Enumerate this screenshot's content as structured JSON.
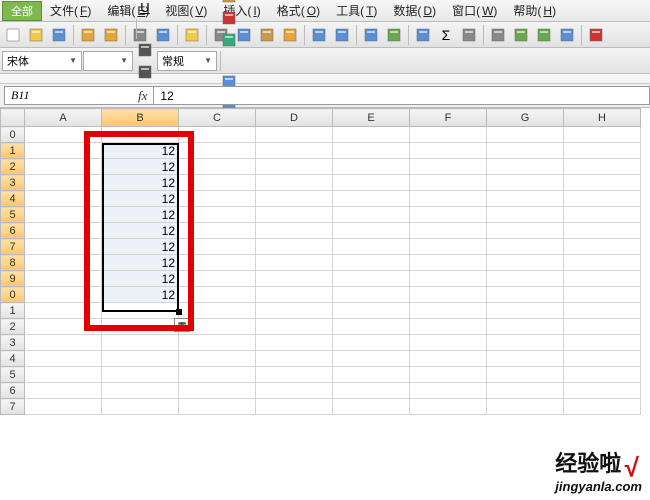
{
  "menu": {
    "all": "全部",
    "items": [
      {
        "label": "文件",
        "key": "F"
      },
      {
        "label": "编辑",
        "key": "E"
      },
      {
        "label": "视图",
        "key": "V"
      },
      {
        "label": "插入",
        "key": "I"
      },
      {
        "label": "格式",
        "key": "O"
      },
      {
        "label": "工具",
        "key": "T"
      },
      {
        "label": "数据",
        "key": "D"
      },
      {
        "label": "窗口",
        "key": "W"
      },
      {
        "label": "帮助",
        "key": "H"
      }
    ]
  },
  "toolbar1_icons": [
    "new-doc",
    "open-doc",
    "save-doc",
    "sep",
    "undo",
    "redo",
    "sep",
    "print",
    "print-preview",
    "sep",
    "highlight",
    "sep",
    "cut",
    "copy",
    "paste",
    "format-painter",
    "sep",
    "sort-asc",
    "sort-desc",
    "sep",
    "hyperlink",
    "func",
    "sep",
    "chart",
    "autosum",
    "search",
    "sep",
    "zoom",
    "toggle-1",
    "toggle-2",
    "filter",
    "sep",
    "record"
  ],
  "toolbar2": {
    "font_name": "宋体",
    "font_size": "",
    "buttons": [
      "bold",
      "italic",
      "underline",
      "sep",
      "align-left",
      "align-center",
      "align-right",
      "align-justify",
      "merge",
      "sep"
    ],
    "number_format": "常规",
    "buttons2": [
      "percent",
      "comma",
      "currency",
      "decrease-dec",
      "increase-dec",
      "sep",
      "indent-dec",
      "indent-inc",
      "borders",
      "fill-color",
      "font-color"
    ]
  },
  "formula_bar": {
    "name": "B11",
    "fx": "fx",
    "value": "12"
  },
  "columns": [
    "A",
    "B",
    "C",
    "D",
    "E",
    "F",
    "G",
    "H"
  ],
  "row_labels": [
    "0",
    "1",
    "2",
    "3",
    "4",
    "5",
    "6",
    "7",
    "8",
    "9",
    "0",
    "1",
    "2",
    "3",
    "4",
    "5",
    "6",
    "7"
  ],
  "selected_col_index": 1,
  "data": {
    "B": [
      "",
      "12",
      "12",
      "12",
      "12",
      "12",
      "12",
      "12",
      "12",
      "12",
      "12",
      "",
      "",
      "",
      "",
      "",
      "",
      ""
    ]
  },
  "selection": {
    "col": "B",
    "from_row": 1,
    "to_row": 10
  },
  "watermark": {
    "brand": "经验啦",
    "check": "√",
    "sub": "jingyanla.com"
  },
  "icon_colors": {
    "new-doc": "#fff",
    "open-doc": "#f3c94b",
    "save-doc": "#5a8fd6",
    "undo": "#e8a43a",
    "redo": "#e8a43a",
    "print": "#888",
    "print-preview": "#5a8fd6",
    "highlight": "#f3c94b",
    "cut": "#888",
    "copy": "#5a8fd6",
    "paste": "#c89b4a",
    "format-painter": "#e8a43a",
    "sort-asc": "#5a8fd6",
    "sort-desc": "#5a8fd6",
    "hyperlink": "#5a8fd6",
    "func": "#6aa84f",
    "chart": "#5a8fd6",
    "autosum": "#333",
    "search": "#888",
    "zoom": "#888",
    "toggle-1": "#6aa84f",
    "toggle-2": "#6aa84f",
    "filter": "#5a8fd6",
    "record": "#c33",
    "bold": "#333",
    "italic": "#333",
    "underline": "#333",
    "align-left": "#555",
    "align-center": "#555",
    "align-right": "#555",
    "align-justify": "#555",
    "merge": "#5a8fd6",
    "percent": "#333",
    "comma": "#333",
    "currency": "#c89b4a",
    "decrease-dec": "#c33",
    "increase-dec": "#3a7",
    "indent-dec": "#5a8fd6",
    "indent-inc": "#5a8fd6",
    "borders": "#555",
    "fill-color": "#f3c94b",
    "font-color": "#c33"
  }
}
